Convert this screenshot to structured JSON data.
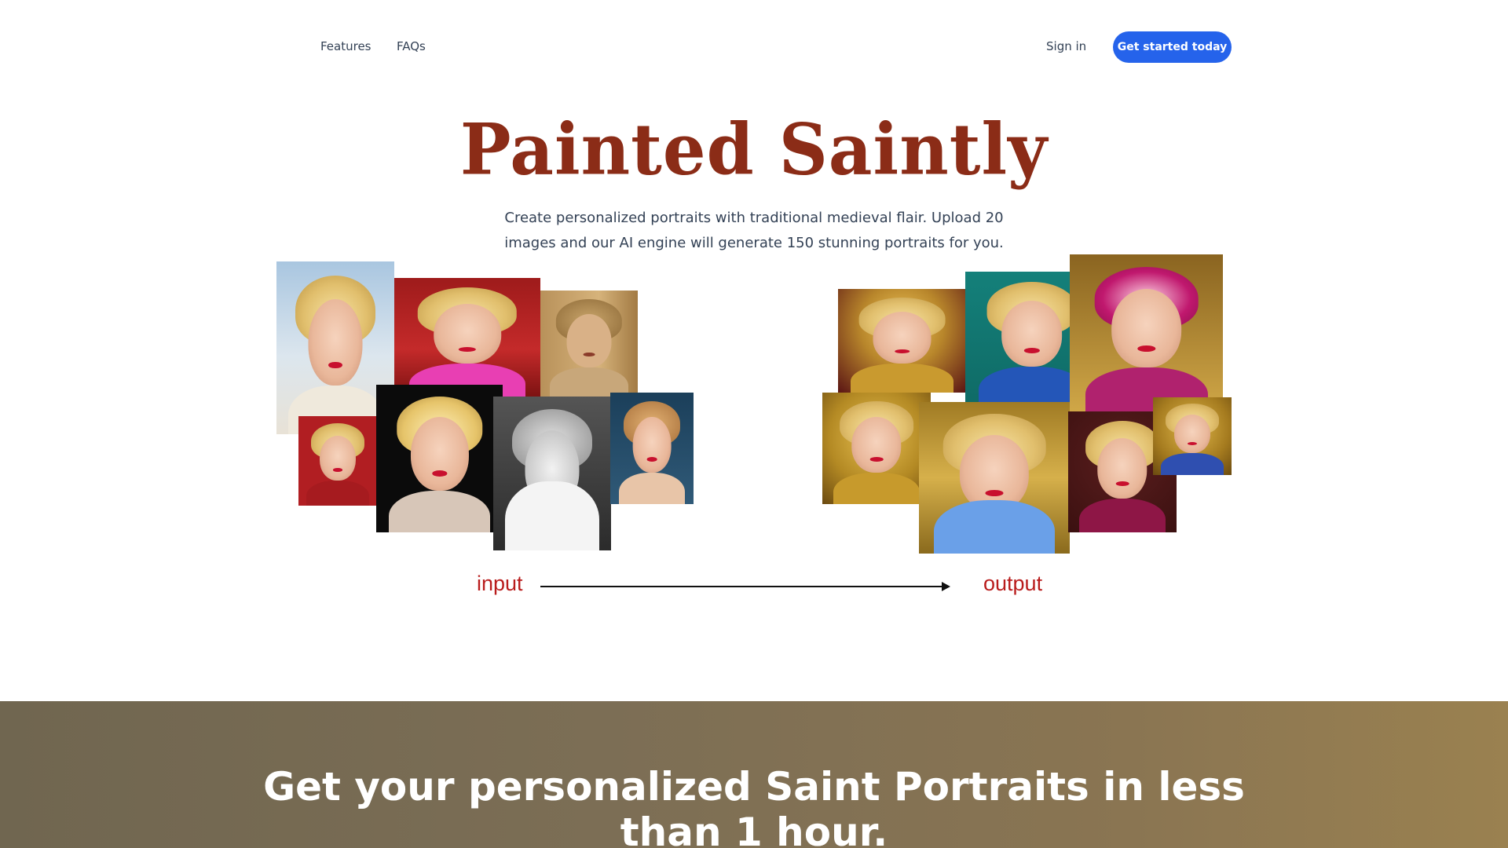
{
  "nav": {
    "features": "Features",
    "faqs": "FAQs",
    "sign_in": "Sign in",
    "cta": "Get started today"
  },
  "hero": {
    "logo_text": "Painted Saintly",
    "subtitle": "Create personalized portraits with traditional medieval flair. Upload 20 images and our AI engine will generate 150 stunning portraits for you."
  },
  "gallery": {
    "input_label": "input",
    "output_label": "output"
  },
  "banner": {
    "title": "Get your personalized Saint Portraits in less than 1 hour."
  },
  "colors": {
    "accent": "#2563eb",
    "logo": "#8b2c17",
    "label": "#b91c1c"
  }
}
